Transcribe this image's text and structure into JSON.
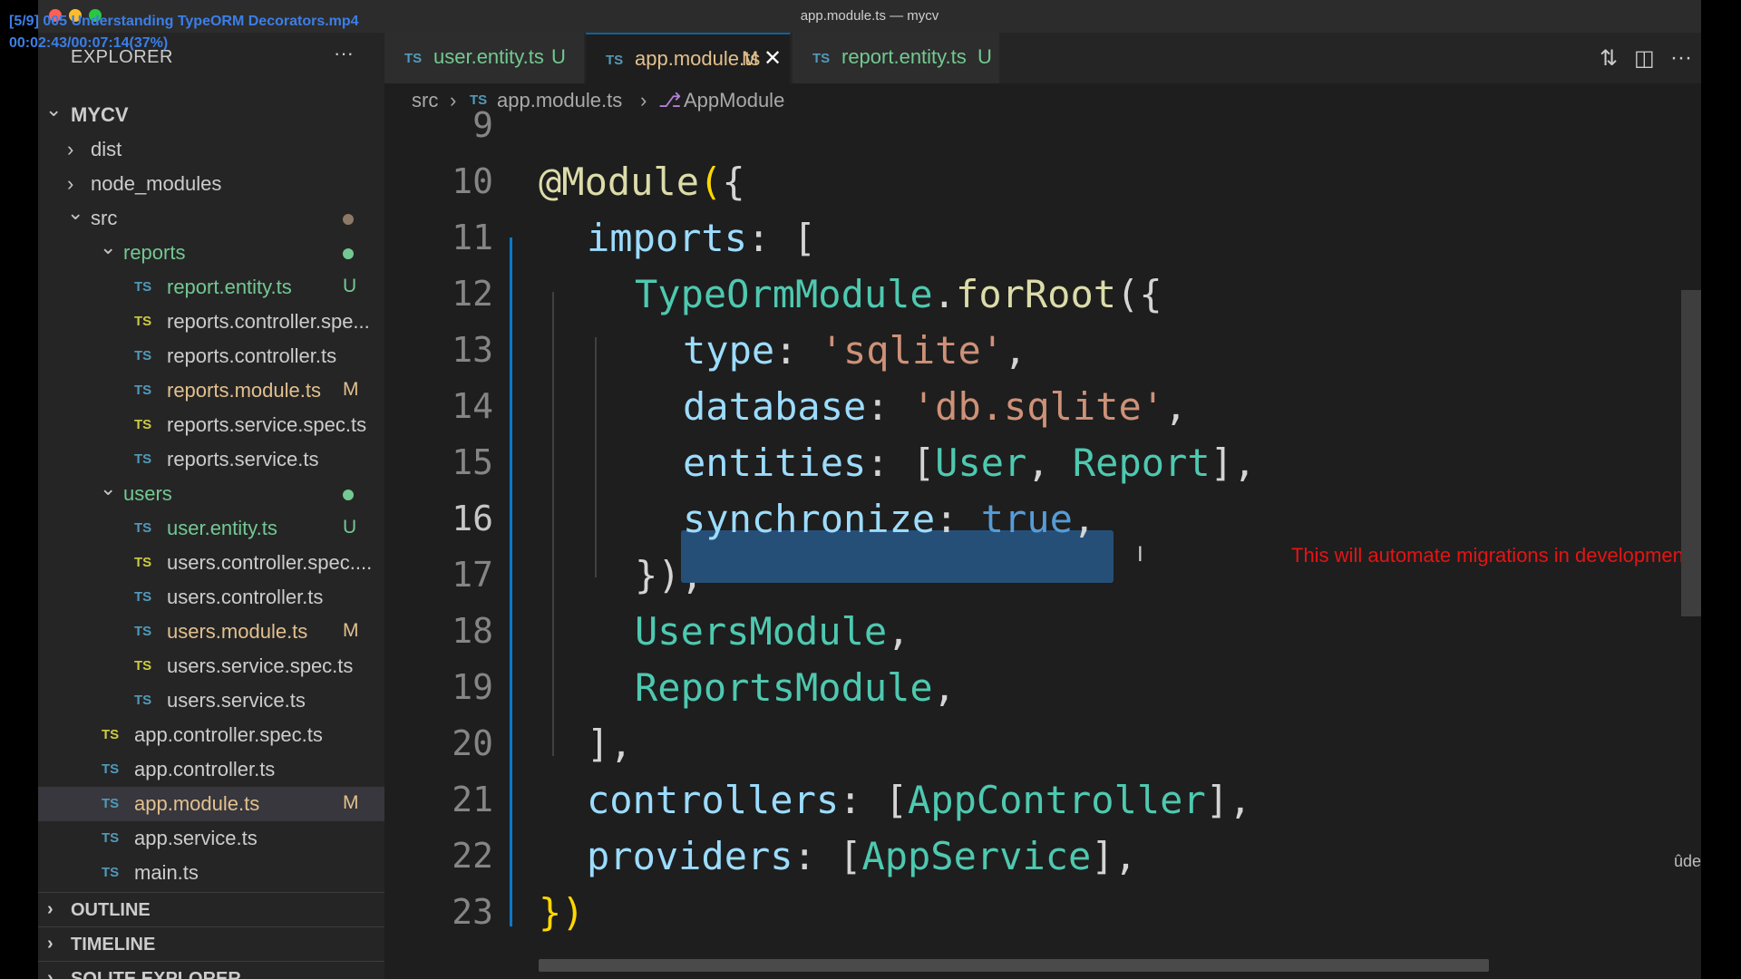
{
  "video_overlay": {
    "title": "[5/9] 005 Understanding TypeORM Decorators.mp4",
    "time": "00:02:43/00:07:14(37%)"
  },
  "window": {
    "title": "app.module.ts — mycv"
  },
  "sidebar": {
    "header": "EXPLORER",
    "more": "···",
    "root": "MYCV",
    "tree": [
      {
        "label": "dist",
        "type": "folder",
        "expanded": false,
        "depth": 1
      },
      {
        "label": "node_modules",
        "type": "folder",
        "expanded": false,
        "depth": 1
      },
      {
        "label": "src",
        "type": "folder",
        "expanded": true,
        "depth": 1,
        "dot_color": "#8c7a66"
      },
      {
        "label": "reports",
        "type": "folder",
        "expanded": true,
        "depth": 2,
        "dot_color": "#73c991",
        "color": "#73c991"
      },
      {
        "label": "report.entity.ts",
        "type": "file",
        "depth": 3,
        "badge": "U",
        "color": "#73c991"
      },
      {
        "label": "reports.controller.spe...",
        "type": "file",
        "depth": 3,
        "ts_color": "#cbcb41"
      },
      {
        "label": "reports.controller.ts",
        "type": "file",
        "depth": 3
      },
      {
        "label": "reports.module.ts",
        "type": "file",
        "depth": 3,
        "badge": "M",
        "color": "#e2c08d"
      },
      {
        "label": "reports.service.spec.ts",
        "type": "file",
        "depth": 3,
        "ts_color": "#cbcb41"
      },
      {
        "label": "reports.service.ts",
        "type": "file",
        "depth": 3
      },
      {
        "label": "users",
        "type": "folder",
        "expanded": true,
        "depth": 2,
        "dot_color": "#73c991",
        "color": "#73c991"
      },
      {
        "label": "user.entity.ts",
        "type": "file",
        "depth": 3,
        "badge": "U",
        "color": "#73c991"
      },
      {
        "label": "users.controller.spec....",
        "type": "file",
        "depth": 3,
        "ts_color": "#cbcb41"
      },
      {
        "label": "users.controller.ts",
        "type": "file",
        "depth": 3
      },
      {
        "label": "users.module.ts",
        "type": "file",
        "depth": 3,
        "badge": "M",
        "color": "#e2c08d"
      },
      {
        "label": "users.service.spec.ts",
        "type": "file",
        "depth": 3,
        "ts_color": "#cbcb41"
      },
      {
        "label": "users.service.ts",
        "type": "file",
        "depth": 3
      },
      {
        "label": "app.controller.spec.ts",
        "type": "file",
        "depth": 2,
        "ts_color": "#cbcb41"
      },
      {
        "label": "app.controller.ts",
        "type": "file",
        "depth": 2
      },
      {
        "label": "app.module.ts",
        "type": "file",
        "depth": 2,
        "badge": "M",
        "color": "#e2c08d",
        "selected": true
      },
      {
        "label": "app.service.ts",
        "type": "file",
        "depth": 2
      },
      {
        "label": "main.ts",
        "type": "file",
        "depth": 2
      }
    ],
    "sections": [
      "OUTLINE",
      "TIMELINE",
      "SQLITE EXPLORER"
    ]
  },
  "tabs": [
    {
      "prefix": "TS",
      "label": "user.entity.ts",
      "status": "U",
      "color": "#73c991",
      "active": false
    },
    {
      "prefix": "TS",
      "label": "app.module.ts",
      "status": "M",
      "color": "#e2c08d",
      "active": true,
      "close": "✕"
    },
    {
      "prefix": "TS",
      "label": "report.entity.ts",
      "status": "U",
      "color": "#73c991",
      "active": false
    }
  ],
  "breadcrumb": {
    "items": [
      "src",
      "app.module.ts",
      "AppModule"
    ],
    "file_prefix": "TS"
  },
  "editor": {
    "current_line": "16",
    "lines": [
      {
        "n": "9",
        "tokens": []
      },
      {
        "n": "10",
        "tokens": [
          [
            "@Module",
            "fn"
          ],
          [
            "(",
            "brk"
          ],
          [
            "{",
            "punc"
          ]
        ]
      },
      {
        "n": "11",
        "tokens": [
          [
            "imports",
            "kw"
          ],
          [
            ": [",
            "punc"
          ]
        ]
      },
      {
        "n": "12",
        "tokens": [
          [
            "TypeOrmModule",
            "cls"
          ],
          [
            ".",
            "punc"
          ],
          [
            "forRoot",
            "fn"
          ],
          [
            "({",
            "punc"
          ]
        ]
      },
      {
        "n": "13",
        "tokens": [
          [
            "type",
            "kw"
          ],
          [
            ": ",
            "punc"
          ],
          [
            "'sqlite'",
            "str"
          ],
          [
            ",",
            "punc"
          ]
        ]
      },
      {
        "n": "14",
        "tokens": [
          [
            "database",
            "kw"
          ],
          [
            ": ",
            "punc"
          ],
          [
            "'db.sqlite'",
            "str"
          ],
          [
            ",",
            "punc"
          ]
        ]
      },
      {
        "n": "15",
        "tokens": [
          [
            "entities",
            "kw"
          ],
          [
            ": [",
            "punc"
          ],
          [
            "User",
            "cls"
          ],
          [
            ", ",
            "punc"
          ],
          [
            "Report",
            "cls"
          ],
          [
            "],",
            "punc"
          ]
        ]
      },
      {
        "n": "16",
        "tokens": [
          [
            "synchronize",
            "kw"
          ],
          [
            ": ",
            "punc"
          ],
          [
            "true",
            "bool"
          ],
          [
            ",",
            "punc"
          ]
        ]
      },
      {
        "n": "17",
        "tokens": [
          [
            "}),",
            "punc"
          ]
        ]
      },
      {
        "n": "18",
        "tokens": [
          [
            "UsersModule",
            "cls"
          ],
          [
            ",",
            "punc"
          ]
        ]
      },
      {
        "n": "19",
        "tokens": [
          [
            "ReportsModule",
            "cls"
          ],
          [
            ",",
            "punc"
          ]
        ]
      },
      {
        "n": "20",
        "tokens": [
          [
            "],",
            "punc"
          ]
        ]
      },
      {
        "n": "21",
        "tokens": [
          [
            "controllers",
            "kw"
          ],
          [
            ": [",
            "punc"
          ],
          [
            "AppController",
            "cls"
          ],
          [
            "],",
            "punc"
          ]
        ]
      },
      {
        "n": "22",
        "tokens": [
          [
            "providers",
            "kw"
          ],
          [
            ": [",
            "punc"
          ],
          [
            "AppService",
            "cls"
          ],
          [
            "],",
            "punc"
          ]
        ]
      },
      {
        "n": "23",
        "tokens": [
          [
            "})",
            "brk"
          ]
        ]
      }
    ],
    "annotation": "This will automate migrations in development environment",
    "cursor_glyph": "I"
  },
  "watermark": "ûdemy",
  "colors": {
    "accent": "#0e639c",
    "selection": "#264f78",
    "annotation": "#e51414",
    "untracked": "#73c991",
    "modified": "#e2c08d"
  }
}
